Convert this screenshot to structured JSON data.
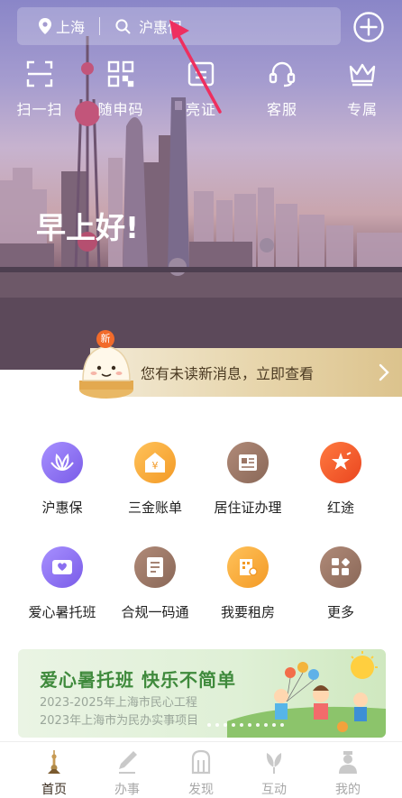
{
  "header": {
    "location": "上海",
    "search_placeholder": "沪惠保"
  },
  "quick_actions": [
    {
      "label": "扫一扫",
      "icon": "scan-icon"
    },
    {
      "label": "随申码",
      "icon": "qr-code-icon"
    },
    {
      "label": "亮证",
      "icon": "id-card-icon"
    },
    {
      "label": "客服",
      "icon": "headset-icon"
    },
    {
      "label": "专属",
      "icon": "crown-icon"
    }
  ],
  "greeting": "早上好!",
  "message": {
    "badge": "新",
    "text": "您有未读新消息，立即查看"
  },
  "services": [
    {
      "label": "沪惠保",
      "icon": "lotus-icon",
      "color": "#8a6ff0"
    },
    {
      "label": "三金账单",
      "icon": "money-house-icon",
      "color": "#f6a734"
    },
    {
      "label": "居住证办理",
      "icon": "residence-card-icon",
      "color": "#9b7665"
    },
    {
      "label": "红途",
      "icon": "star-flag-icon",
      "color": "#f0562a"
    },
    {
      "label": "爱心暑托班",
      "icon": "heart-card-icon",
      "color": "#8a6ff0"
    },
    {
      "label": "合规一码通",
      "icon": "document-icon",
      "color": "#9b7665"
    },
    {
      "label": "我要租房",
      "icon": "rent-house-icon",
      "color": "#f6a734"
    },
    {
      "label": "更多",
      "icon": "more-grid-icon",
      "color": "#9b7665"
    }
  ],
  "promo": {
    "title": "爱心暑托班 快乐不简单",
    "line1": "2023-2025年上海市民心工程",
    "line2": "2023年上海市为民办实事项目"
  },
  "tabs": [
    {
      "label": "首页",
      "icon": "home-tower-icon",
      "active": true
    },
    {
      "label": "办事",
      "icon": "pen-icon",
      "active": false
    },
    {
      "label": "发现",
      "icon": "discover-icon",
      "active": false
    },
    {
      "label": "互动",
      "icon": "flower-icon",
      "active": false
    },
    {
      "label": "我的",
      "icon": "profile-icon",
      "active": false
    }
  ]
}
